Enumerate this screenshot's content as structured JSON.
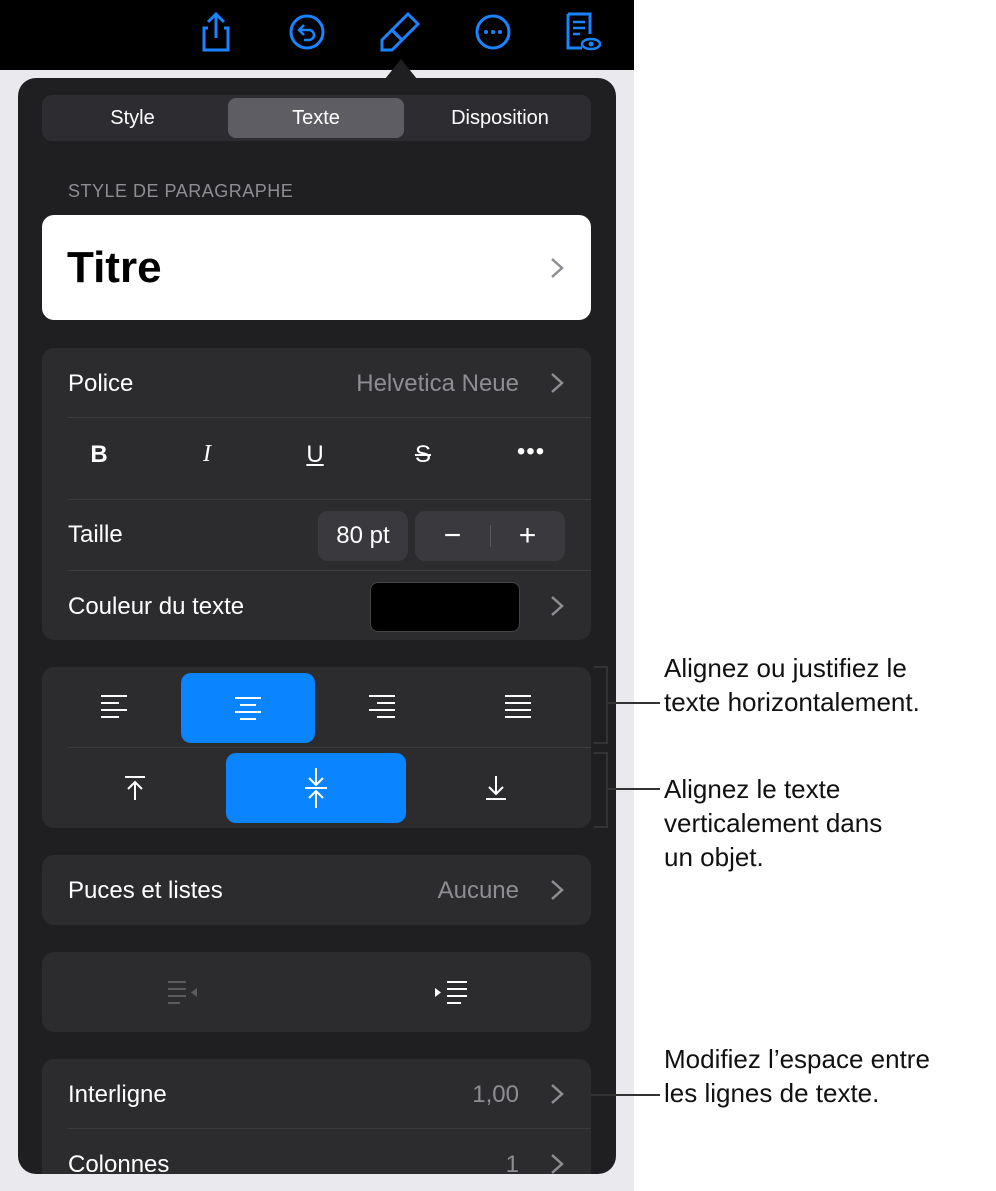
{
  "toolbar": {
    "icons": [
      "share-icon",
      "undo-icon",
      "paintbrush-icon",
      "more-icon",
      "document-preview-icon"
    ],
    "accent": "#1a84ff"
  },
  "tabs": [
    {
      "label": "Style",
      "selected": false
    },
    {
      "label": "Texte",
      "selected": true
    },
    {
      "label": "Disposition",
      "selected": false
    }
  ],
  "paragraph_style": {
    "section_label": "STYLE DE PARAGRAPHE",
    "value": "Titre"
  },
  "font": {
    "label": "Police",
    "value": "Helvetica Neue"
  },
  "format_buttons": [
    "B",
    "I",
    "U",
    "S",
    "•••"
  ],
  "size": {
    "label": "Taille",
    "value": "80 pt",
    "minus": "−",
    "plus": "+"
  },
  "text_color": {
    "label": "Couleur du texte",
    "swatch": "#000000"
  },
  "alignment": {
    "horizontal": [
      "align-left-icon",
      "align-center-icon",
      "align-right-icon",
      "justify-icon"
    ],
    "horizontal_selected": 1,
    "vertical": [
      "align-top-icon",
      "align-middle-icon",
      "align-bottom-icon"
    ],
    "vertical_selected": 1,
    "selected_color": "#0a84ff"
  },
  "bullets": {
    "label": "Puces et listes",
    "value": "Aucune"
  },
  "indent": [
    "decrease-indent-icon",
    "increase-indent-icon"
  ],
  "line_spacing": {
    "label": "Interligne",
    "value": "1,00"
  },
  "columns": {
    "label": "Colonnes",
    "value": "1"
  },
  "annotations": [
    {
      "lines": [
        "Alignez ou justifiez le",
        "texte horizontalement."
      ]
    },
    {
      "lines": [
        "Alignez le texte",
        "verticalement dans",
        "un objet."
      ]
    },
    {
      "lines": [
        "Modifiez l’espace entre",
        "les lignes de texte."
      ]
    }
  ]
}
